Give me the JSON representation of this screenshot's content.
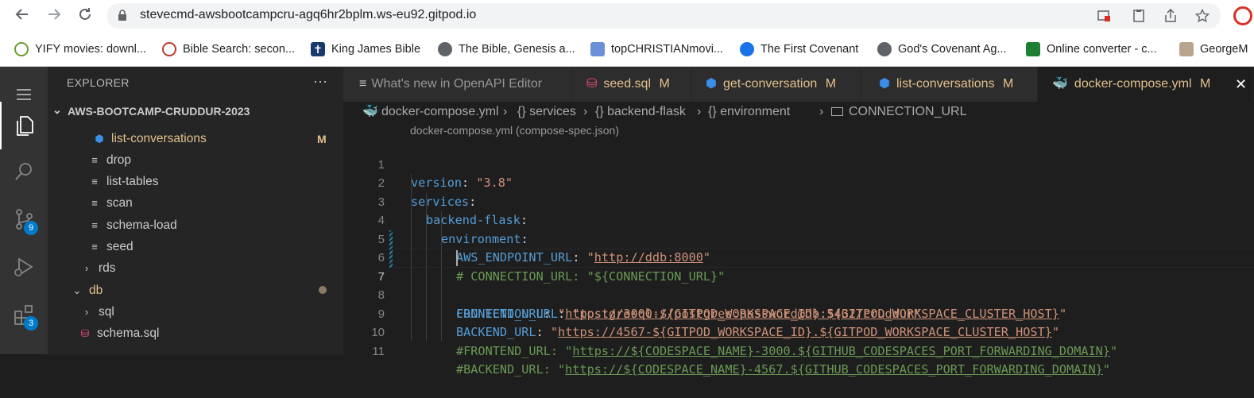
{
  "browser": {
    "url": "stevecmd-awsbootcampcru-agq6hr2bplm.ws-eu92.gitpod.io",
    "bookmarks": [
      {
        "label": "YIFY movies: downl...",
        "icon": "yify-icon"
      },
      {
        "label": "Bible Search: secon...",
        "icon": "globe-cross-icon"
      },
      {
        "label": "King James Bible",
        "icon": "cross-icon"
      },
      {
        "label": "The Bible, Genesis a...",
        "icon": "globe-icon"
      },
      {
        "label": "topCHRISTIANmovi...",
        "icon": "film-icon"
      },
      {
        "label": "The First Covenant",
        "icon": "edge-icon"
      },
      {
        "label": "God's Covenant Ag...",
        "icon": "globe-icon"
      },
      {
        "label": "Online converter - c...",
        "icon": "converter-icon"
      },
      {
        "label": "GeorgeM",
        "icon": "avatar-icon"
      }
    ]
  },
  "explorer": {
    "title": "EXPLORER",
    "more": "···",
    "project": "AWS-BOOTCAMP-CRUDDUR-2023",
    "items": [
      {
        "label": "list-conversations",
        "status": "M"
      },
      {
        "label": "drop"
      },
      {
        "label": "list-tables"
      },
      {
        "label": "scan"
      },
      {
        "label": "schema-load"
      },
      {
        "label": "seed"
      },
      {
        "label": "rds"
      },
      {
        "label": "db"
      },
      {
        "label": "sql"
      },
      {
        "label": "schema.sql"
      }
    ]
  },
  "activity": {
    "scm_badge": "9",
    "ext_badge": "3"
  },
  "tabs": [
    {
      "label": "What's new in OpenAPI Editor",
      "status": ""
    },
    {
      "label": "seed.sql",
      "status": "M"
    },
    {
      "label": "get-conversation",
      "status": "M"
    },
    {
      "label": "list-conversations",
      "status": "M"
    },
    {
      "label": "docker-compose.yml",
      "status": "M"
    }
  ],
  "breadcrumb": {
    "file": "docker-compose.yml",
    "b1": "{} services",
    "b2": "{} backend-flask",
    "b3": "{} environment",
    "b4": "CONNECTION_URL"
  },
  "schema_hint": "docker-compose.yml (compose-spec.json)",
  "code": {
    "l1a": "version",
    "l1b": ": ",
    "l1c": "\"3.8\"",
    "l2a": "services",
    "l2b": ":",
    "l3a": "backend-flask",
    "l3b": ":",
    "l4a": "environment",
    "l4b": ":",
    "l5a": "AWS_ENDPOINT_URL",
    "l5b": ": ",
    "l5c": "\"",
    "l5d": "http://ddb:8000",
    "l5e": "\"",
    "l6": "# CONNECTION_URL: \"${CONNECTION_URL}\"",
    "l7a": "CONNECTION_URL",
    "l7b": ": ",
    "l7c": "\"postgresql://postgres:password@db:5432/cruddur\"",
    "l8a": "FRONTEND_URL",
    "l8b": ": ",
    "l8c": "\"",
    "l8d": "https://3000-${GITPOD_WORKSPACE_ID}.${GITPOD_WORKSPACE_CLUSTER_HOST}",
    "l8e": "\"",
    "l9a": "BACKEND_URL",
    "l9b": ": ",
    "l9c": "\"",
    "l9d": "https://4567-${GITPOD_WORKSPACE_ID}.${GITPOD_WORKSPACE_CLUSTER_HOST}",
    "l9e": "\"",
    "l10a": "#FRONTEND_URL: \"",
    "l10b": "https://${CODESPACE_NAME}-3000.${GITHUB_CODESPACES_PORT_FORWARDING_DOMAIN}",
    "l10c": "\"",
    "l11a": "#BACKEND_URL: \"",
    "l11b": "https://${CODESPACE_NAME}-4567.${GITHUB_CODESPACES_PORT_FORWARDING_DOMAIN}",
    "l11c": "\"",
    "line_numbers": [
      "1",
      "2",
      "3",
      "4",
      "5",
      "6",
      "7",
      "8",
      "9",
      "10",
      "11"
    ]
  },
  "colors": {
    "modified": "#e2c08d",
    "keyword": "#569cd6",
    "string": "#ce9178",
    "comment": "#6a9955",
    "badge": "#007acc"
  }
}
